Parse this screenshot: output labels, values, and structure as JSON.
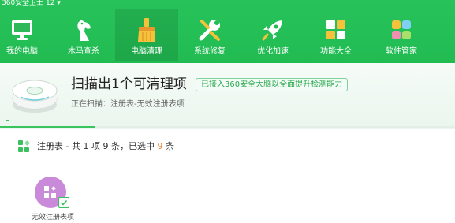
{
  "header": {
    "account_text": "360安全卫士 12 ▾",
    "nav": [
      {
        "label": "我的电脑",
        "icon": "computer-icon"
      },
      {
        "label": "木马查杀",
        "icon": "horse-icon"
      },
      {
        "label": "电脑清理",
        "icon": "broom-icon",
        "active": true
      },
      {
        "label": "系统修复",
        "icon": "wrench-icon"
      },
      {
        "label": "优化加速",
        "icon": "rocket-icon"
      },
      {
        "label": "功能大全",
        "icon": "grid-icon"
      },
      {
        "label": "软件管家",
        "icon": "apps-icon"
      }
    ]
  },
  "scan": {
    "title": "扫描出1个可清理项",
    "badge": "已接入360安全大脑以全面提升检测能力",
    "status": "正在扫描：注册表-无效注册表项",
    "progress": 0.21
  },
  "summary": {
    "prefix": "注册表 - 共 1 项 9 条，已选中 ",
    "selected_count": "9",
    "suffix": " 条"
  },
  "items": [
    {
      "label": "无效注册表项",
      "checked": true
    }
  ],
  "colors": {
    "brand_green": "#24be55",
    "accent_orange": "#f07b2e",
    "item_purple": "#c98ad9"
  }
}
